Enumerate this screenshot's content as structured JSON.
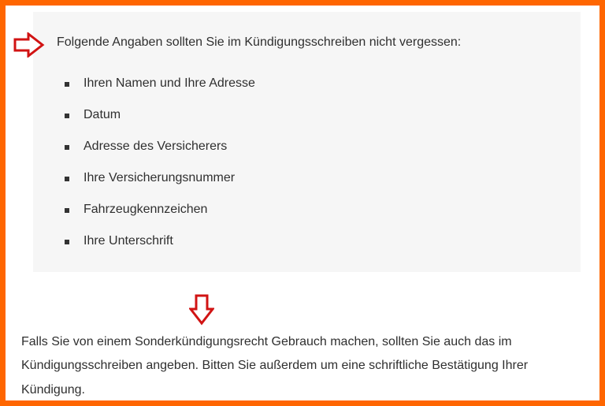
{
  "intro": "Folgende Angaben sollten Sie im Kündigungsschreiben nicht vergessen:",
  "bullets": {
    "0": "Ihren Namen und Ihre Adresse",
    "1": "Datum",
    "2": "Adresse des Versicherers",
    "3": "Ihre Versicherungsnummer",
    "4": "Fahrzeugkennzeichen",
    "5": "Ihre Unterschrift"
  },
  "bottom": "Falls Sie von einem Sonderkündigungsrecht Gebrauch machen, sollten Sie auch das im Kündigungsschreiben angeben. Bitten Sie außerdem um eine schriftliche Bestätigung Ihrer Kündigung."
}
